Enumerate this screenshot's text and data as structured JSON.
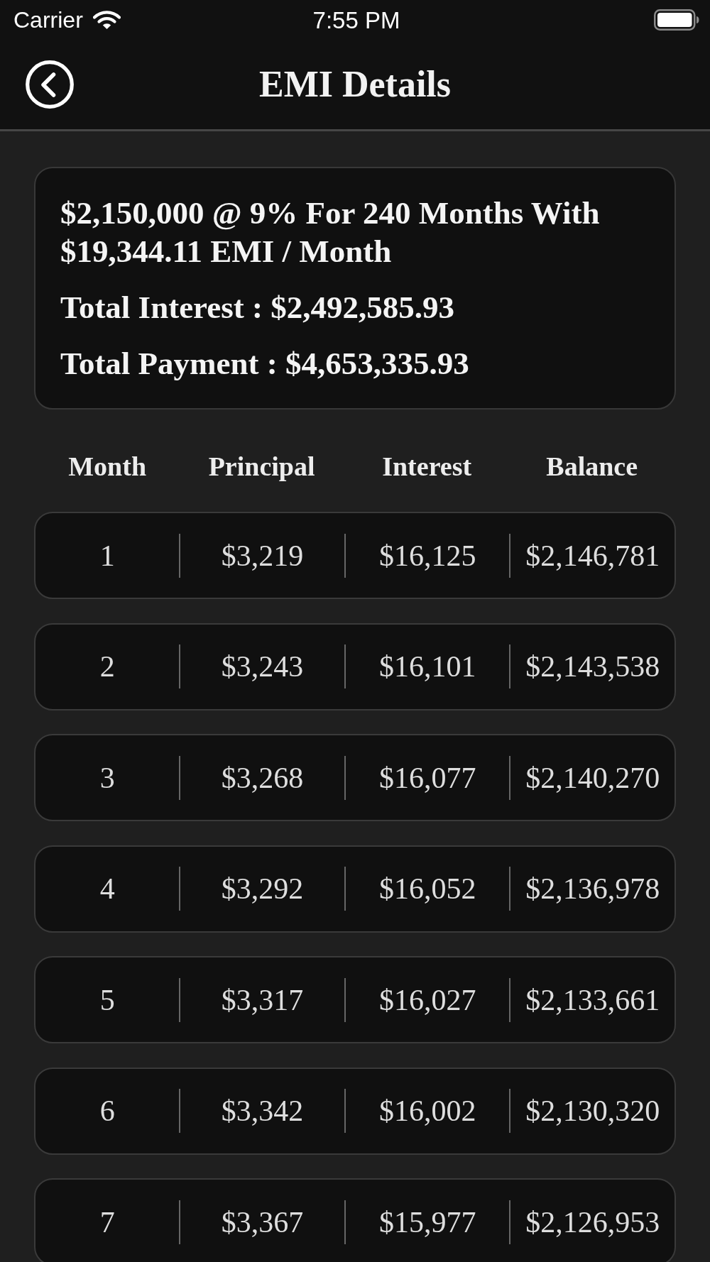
{
  "status_bar": {
    "carrier": "Carrier",
    "time": "7:55 PM"
  },
  "nav_bar": {
    "title": "EMI Details"
  },
  "summary": {
    "headline": "$2,150,000 @ 9% For 240 Months With $19,344.11 EMI / Month",
    "totals": [
      "Total Interest : $2,492,585.93",
      "Total Payment : $4,653,335.93"
    ]
  },
  "table": {
    "columns": [
      "Month",
      "Principal",
      "Interest",
      "Balance"
    ],
    "rows": [
      [
        "1",
        "$3,219",
        "$16,125",
        "$2,146,781"
      ],
      [
        "2",
        "$3,243",
        "$16,101",
        "$2,143,538"
      ],
      [
        "3",
        "$3,268",
        "$16,077",
        "$2,140,270"
      ],
      [
        "4",
        "$3,292",
        "$16,052",
        "$2,136,978"
      ],
      [
        "5",
        "$3,317",
        "$16,027",
        "$2,133,661"
      ],
      [
        "6",
        "$3,342",
        "$16,002",
        "$2,130,320"
      ],
      [
        "7",
        "$3,367",
        "$15,977",
        "$2,126,953"
      ]
    ]
  }
}
